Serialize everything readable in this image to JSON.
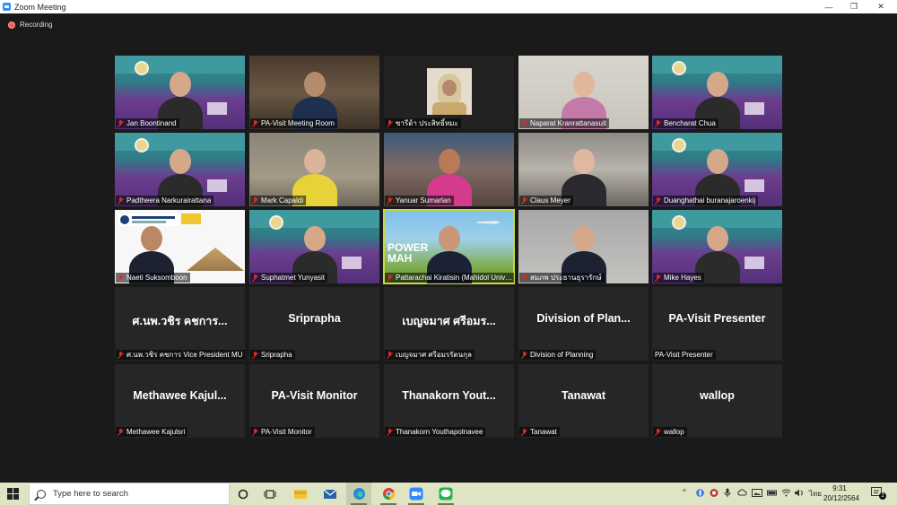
{
  "window": {
    "title": "Zoom Meeting",
    "controls": [
      "—",
      "❐",
      "✕"
    ]
  },
  "recording": {
    "label": "Recording"
  },
  "colors": {
    "active_speaker": "#c9d93a",
    "muted_icon": "#e02828",
    "record_dot": "#ff5a5a"
  },
  "tiles": [
    {
      "name": "Jan Boontinand",
      "kind": "video",
      "bg": "mahidol"
    },
    {
      "name": "PA-Visit Meeting Room",
      "kind": "video",
      "bg": "room"
    },
    {
      "name": "ซารีด้า ประสิทธิ์หมะ",
      "kind": "photo",
      "bg": "dark"
    },
    {
      "name": "Naparat Kranrattanasuit",
      "kind": "video",
      "bg": "light"
    },
    {
      "name": "Bencharat Chua",
      "kind": "video",
      "bg": "mahidol"
    },
    {
      "name": "Padtheera Narkurairattana",
      "kind": "video",
      "bg": "mahidol"
    },
    {
      "name": "Mark Capaldi",
      "kind": "video",
      "bg": "yellowroom"
    },
    {
      "name": "Yanuar Sumarlan",
      "kind": "video",
      "bg": "pink"
    },
    {
      "name": "Claus Meyer",
      "kind": "video",
      "bg": "office"
    },
    {
      "name": "Duanghathai buranajaroenkij",
      "kind": "video",
      "bg": "mahidol"
    },
    {
      "name": "Naeti Suksomboon",
      "kind": "video",
      "bg": "white"
    },
    {
      "name": "Suphatmet Yunyasit",
      "kind": "video",
      "bg": "mahidol"
    },
    {
      "name": "Pattarachai Kiratisin (Mahidol Universit...",
      "kind": "video",
      "bg": "green",
      "active": true,
      "overlay": "POWER\nMAH"
    },
    {
      "name": "สมภพ ประธานธุรารักษ์",
      "kind": "video",
      "bg": "grey"
    },
    {
      "name": "Mike Hayes",
      "kind": "video",
      "bg": "mahidol"
    },
    {
      "name": "ศ.นพ.วชิร คชการ Vice President MU",
      "big": "ศ.นพ.วชิร คชการ...",
      "kind": "name"
    },
    {
      "name": "Sriprapha",
      "big": "Sriprapha",
      "kind": "name"
    },
    {
      "name": "เบญจมาศ ศรีอมรรัตนกุล",
      "big": "เบญจมาศ ศรีอมร...",
      "kind": "name"
    },
    {
      "name": "Division of Planning",
      "big": "Division of Plan...",
      "kind": "name"
    },
    {
      "name": "PA-Visit Presenter",
      "big": "PA-Visit Presenter",
      "kind": "name",
      "nomic": true
    },
    {
      "name": "Methawee Kajulsri",
      "big": "Methawee Kajul...",
      "kind": "name"
    },
    {
      "name": "PA-Visit Monitor",
      "big": "PA-Visit Monitor",
      "kind": "name"
    },
    {
      "name": "Thanakorn Youthapolnavee",
      "big": "Thanakorn Yout...",
      "kind": "name"
    },
    {
      "name": "Tanawat",
      "big": "Tanawat",
      "kind": "name"
    },
    {
      "name": "wallop",
      "big": "wallop",
      "kind": "name"
    }
  ],
  "taskbar": {
    "search_placeholder": "Type here to search",
    "ime": "ไทย",
    "time": "9:31",
    "date": "20/12/2564",
    "notifications": "2",
    "apps": [
      "cortana-icon",
      "task-view-icon",
      "file-explorer-icon",
      "mail-icon",
      "edge-icon",
      "chrome-icon",
      "zoom-icon",
      "line-icon"
    ]
  }
}
